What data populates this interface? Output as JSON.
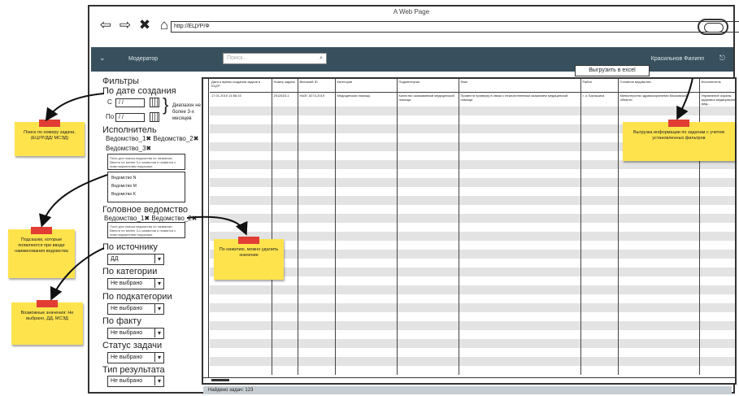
{
  "browser": {
    "title": "A Web Page",
    "url": "http://ЕЦУР/Ф",
    "nav": {
      "back": "⇦",
      "forward": "⇨",
      "stop": "✖",
      "home": "⌂"
    }
  },
  "appbar": {
    "menu_icon": "chevron-down-icon",
    "module": "Модератор",
    "search_placeholder": "Поиск...",
    "user": "Красильнов Филипп",
    "exit_icon": "exit-icon"
  },
  "filters": {
    "title": "Фильтры",
    "by_date": "По дате создания",
    "from_label": "С",
    "to_label": "По",
    "date_from": "/ /",
    "date_to": "/ /",
    "range_note": "Диапазон не более 3-х месяцев",
    "executor_title": "Исполнитель",
    "executor_tags": "Ведомство_1✖ Ведомство_2✖",
    "executor_tags2": "Ведомство_3✖",
    "executor_hint": "Поле для поиска ведомства по названию. Ввести не менее 3-х символов и появятся с ними вариантами подсказки",
    "executor_options": [
      "Ведомство N",
      "Ведомство M",
      "Ведомство K"
    ],
    "head_title": "Головное ведомство",
    "head_tags": "Ведомство_1✖ Ведомство_2✖",
    "head_hint": "Поле для поиска ведомства по названию. Ввести не менее 3-х символов и появятся с ними вариантами подсказки",
    "source_title": "По источнику",
    "source_value": "ДД",
    "category_title": "По категории",
    "category_value": "Не выбрано",
    "subcategory_title": "По подкатегории",
    "subcategory_value": "Не выбрано",
    "fact_title": "По факту",
    "fact_value": "Не выбрано",
    "status_title": "Статус задачи",
    "status_value": "Не выбрано",
    "result_title": "Тип результата",
    "result_value": "Не выбрано"
  },
  "grid": {
    "export_label": "Выгрузить в excel",
    "columns": [
      "Дата и время создания задачи в ЕЦУР",
      "Номер задачи",
      "Внешний ID",
      "Категория",
      "Подкатегория",
      "Факт",
      "Район",
      "Головное ведомство",
      "Исполнитель"
    ],
    "row1": [
      "17.01.2019 14:56:15",
      "2012623-1",
      "НАЗГ-0274-2019",
      "Медицинская помощь",
      "Качество оказываемой медицинской помощи",
      "Провести проверку в связи с некачественным оказанием медицинской помощи",
      "г. о. Балашиха",
      "Министерство здравоохранения Московской области",
      "Управление охраны здоровья медицинских фед..."
    ],
    "footer": "Найдено задач: 123"
  },
  "notes": {
    "search_number": "Поиск по номеру задачи, (ЕЦУР/ДД/ МСЭД)",
    "hints": "Подсказки, которые появляются при вводе наименования ведомства",
    "values": "Возможные значения: Не выбрано, ДД, МСЭД",
    "delete": "По нажатию, можно удалить значение",
    "export": "Выгрузка информации по задачам с учетом установленных фильтров"
  }
}
